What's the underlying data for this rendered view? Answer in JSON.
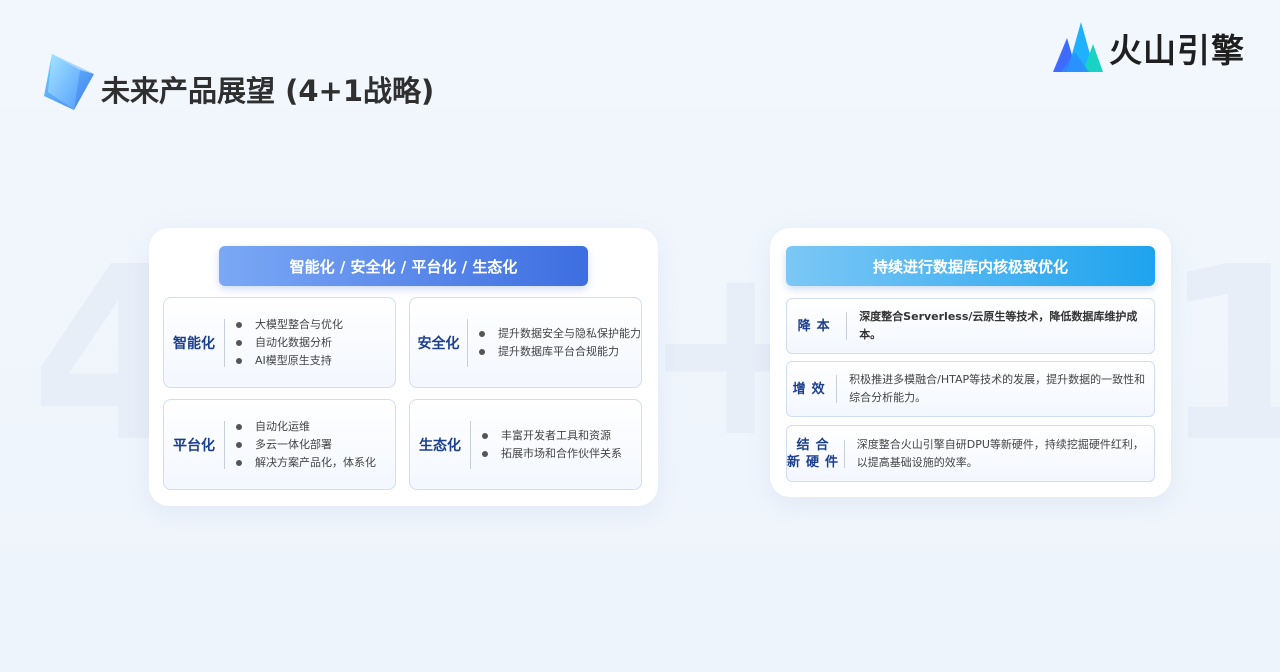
{
  "title": "未来产品展望 (4+1战略)",
  "logo": {
    "text": "火山引擎",
    "colors": [
      "#3d6bff",
      "#1fb0ff",
      "#18d2c4"
    ]
  },
  "background_digits": {
    "left": "4",
    "middle": "+",
    "right": "1"
  },
  "left_panel": {
    "header": "智能化 / 安全化 / 平台化 / 生态化",
    "cards": [
      {
        "label": "智能化",
        "items": [
          "大模型整合与优化",
          "自动化数据分析",
          "AI模型原生支持"
        ]
      },
      {
        "label": "安全化",
        "items": [
          "提升数据安全与隐私保护能力",
          "提升数据库平台合规能力"
        ]
      },
      {
        "label": "平台化",
        "items": [
          "自动化运维",
          "多云一体化部署",
          "解决方案产品化，体系化"
        ]
      },
      {
        "label": "生态化",
        "items": [
          "丰富开发者工具和资源",
          "拓展市场和合作伙伴关系"
        ]
      }
    ]
  },
  "right_panel": {
    "header": "持续进行数据库内核极致优化",
    "rows": [
      {
        "label": "降本",
        "text": "深度整合Serverless/云原生等技术，降低数据库维护成本。"
      },
      {
        "label": "增效",
        "text": "积极推进多模融合/HTAP等技术的发展，提升数据的一致性和综合分析能力。"
      },
      {
        "label_line1": "结合",
        "label_line2": "新硬件",
        "text": "深度整合火山引擎自研DPU等新硬件，持续挖掘硬件红利，以提高基础设施的效率。"
      }
    ]
  },
  "colors": {
    "accent_blue": "#3d6ee0",
    "label_navy": "#1d3f8f",
    "cyan": "#1fa3ee"
  }
}
